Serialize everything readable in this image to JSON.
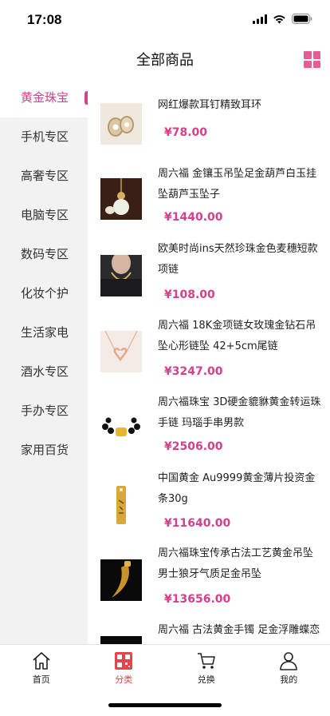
{
  "status_bar": {
    "time": "17:08",
    "icons": [
      "signal-icon",
      "wifi-icon",
      "battery-icon"
    ]
  },
  "header": {
    "title": "全部商品",
    "grid_icon": "grid-icon"
  },
  "sidebar": {
    "items": [
      {
        "label": "黄金珠宝",
        "active": true
      },
      {
        "label": "手机专区"
      },
      {
        "label": "高奢专区"
      },
      {
        "label": "电脑专区"
      },
      {
        "label": "数码专区"
      },
      {
        "label": "化妆个护"
      },
      {
        "label": "生活家电"
      },
      {
        "label": "酒水专区"
      },
      {
        "label": "手办专区"
      },
      {
        "label": "家用百货"
      }
    ]
  },
  "products": [
    {
      "title": "网红爆款耳钉精致耳环",
      "price": "¥78.00"
    },
    {
      "title": "周六福 金镶玉吊坠足金葫芦白玉挂坠葫芦玉坠子",
      "price": "¥1440.00"
    },
    {
      "title": "欧美时尚ins天然珍珠金色麦穗短款项链",
      "price": "¥108.00"
    },
    {
      "title": "周六福 18K金项链女玫瑰金钻石吊坠心形链坠 42+5cm尾链",
      "price": "¥3247.00"
    },
    {
      "title": "周六福珠宝 3D硬金貔貅黄金转运珠手链 玛瑙手串男款",
      "price": "¥2506.00"
    },
    {
      "title": "中国黄金 Au9999黄金薄片投资金条30g",
      "price": "¥11640.00"
    },
    {
      "title": "周六福珠宝传承古法工艺黄金吊坠男士狼牙气质足金吊坠",
      "price": "¥13656.00"
    },
    {
      "title": "周六福 古法黄金手镯 足金浮雕蝶恋",
      "price": ""
    }
  ],
  "tab_bar": {
    "tabs": [
      {
        "label": "首页",
        "icon": "home-icon"
      },
      {
        "label": "分类",
        "icon": "category-icon",
        "active": true
      },
      {
        "label": "兑换",
        "icon": "cart-icon"
      },
      {
        "label": "我的",
        "icon": "user-icon"
      }
    ]
  },
  "colors": {
    "accent": "#d2418a",
    "tab_active": "#e2454b",
    "sidebar_bg": "#f2f2f2"
  }
}
